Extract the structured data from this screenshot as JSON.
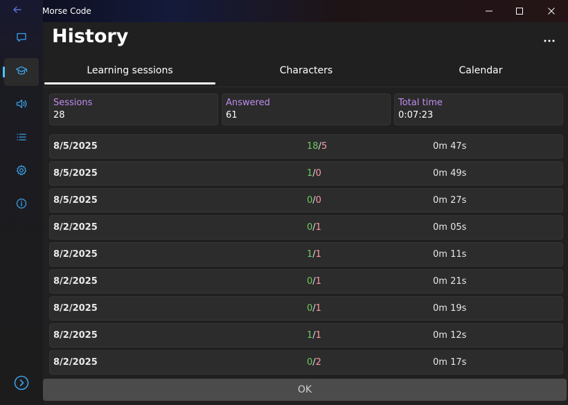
{
  "window": {
    "app_title": "Morse Code",
    "minimize_icon": "minimize-icon",
    "maximize_icon": "maximize-icon",
    "close_icon": "close-icon"
  },
  "sidebar": {
    "items": [
      {
        "icon": "chat-icon"
      },
      {
        "icon": "learning-icon",
        "active": true
      },
      {
        "icon": "speaker-icon"
      },
      {
        "icon": "list-icon"
      },
      {
        "icon": "gear-icon"
      },
      {
        "icon": "info-icon"
      }
    ],
    "expand_icon": "chevron-right-circle-icon",
    "accent_color": "#4cc2ff"
  },
  "page": {
    "title": "History",
    "more_icon": "more-icon"
  },
  "tabs": [
    {
      "label": "Learning sessions",
      "selected": true
    },
    {
      "label": "Characters",
      "selected": false
    },
    {
      "label": "Calendar",
      "selected": false
    }
  ],
  "stats": [
    {
      "label": "Sessions",
      "value": "28"
    },
    {
      "label": "Answered",
      "value": "61"
    },
    {
      "label": "Total time",
      "value": "0:07:23"
    }
  ],
  "sessions": [
    {
      "date": "8/5/2025",
      "correct": "18",
      "wrong": "5",
      "duration": "0m 47s"
    },
    {
      "date": "8/5/2025",
      "correct": "1",
      "wrong": "0",
      "duration": "0m 49s"
    },
    {
      "date": "8/5/2025",
      "correct": "0",
      "wrong": "0",
      "duration": "0m 27s"
    },
    {
      "date": "8/2/2025",
      "correct": "0",
      "wrong": "1",
      "duration": "0m 05s"
    },
    {
      "date": "8/2/2025",
      "correct": "1",
      "wrong": "1",
      "duration": "0m 11s"
    },
    {
      "date": "8/2/2025",
      "correct": "0",
      "wrong": "1",
      "duration": "0m 21s"
    },
    {
      "date": "8/2/2025",
      "correct": "0",
      "wrong": "1",
      "duration": "0m 19s"
    },
    {
      "date": "8/2/2025",
      "correct": "1",
      "wrong": "1",
      "duration": "0m 12s"
    },
    {
      "date": "8/2/2025",
      "correct": "0",
      "wrong": "2",
      "duration": "0m 17s"
    }
  ],
  "score_separator": "/",
  "colors": {
    "correct": "#6ccb5f",
    "wrong": "#ff99a4",
    "stat_label": "#c08cf0"
  },
  "footer": {
    "ok_label": "OK"
  }
}
